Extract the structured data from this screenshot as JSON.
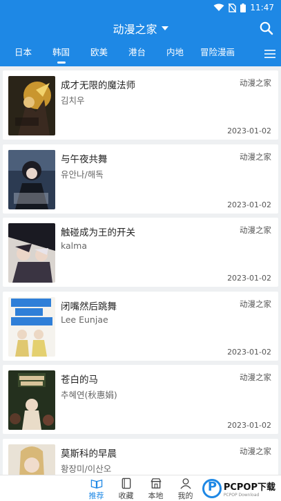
{
  "status": {
    "time": "11:47"
  },
  "header": {
    "title": "动漫之家"
  },
  "tabs": [
    "日本",
    "韩国",
    "欧美",
    "港台",
    "内地",
    "冒险漫画"
  ],
  "cards": [
    {
      "title": "成才无限的魔法师",
      "author": "김치우",
      "source": "动漫之家",
      "date": "2023-01-02"
    },
    {
      "title": "与午夜共舞",
      "author": "유안나/해독",
      "source": "动漫之家",
      "date": "2023-01-02"
    },
    {
      "title": "触碰成为王的开关",
      "author": "kalma",
      "source": "动漫之家",
      "date": "2023-01-02"
    },
    {
      "title": "闭嘴然后跳舞",
      "author": "Lee Eunjae",
      "source": "动漫之家",
      "date": "2023-01-02"
    },
    {
      "title": "苍白的马",
      "author": "추혜연(秋惠娟)",
      "source": "动漫之家",
      "date": "2023-01-02"
    },
    {
      "title": "莫斯科的早晨",
      "author": "황장미/이산오",
      "source": "动漫之家",
      "date": ""
    }
  ],
  "nav": [
    "推荐",
    "收藏",
    "本地",
    "我的"
  ],
  "watermark": {
    "main": "PCPOP下载",
    "sub": "PCPOP Download"
  },
  "colors": {
    "primary": "#1e88e5"
  }
}
